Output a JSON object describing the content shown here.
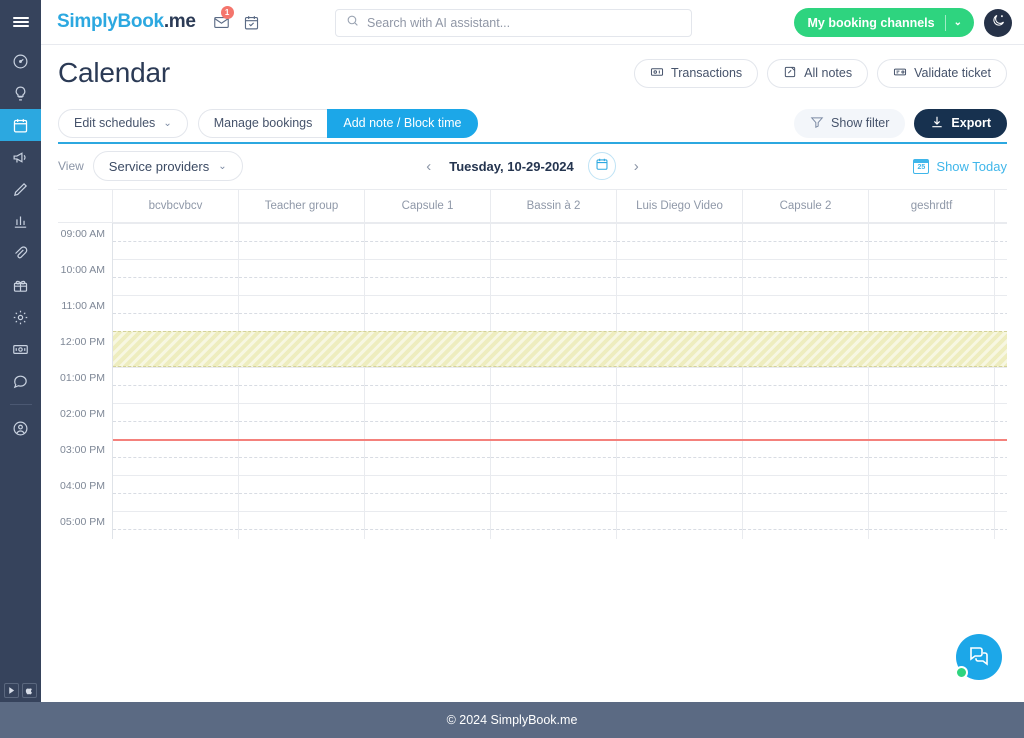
{
  "header": {
    "menu_icon": "hamburger-icon",
    "brand_first": "SimplyBook",
    "brand_second": ".me",
    "mail_icon": "envelope-icon",
    "mail_badge": "1",
    "tasks_icon": "calendar-check-icon",
    "search_placeholder": "Search with AI assistant...",
    "search_value": "",
    "search_icon": "search-icon",
    "booking_channels_label": "My booking channels",
    "booking_channels_icon": "link-icon",
    "booking_channels_chevron": "⌄",
    "theme_toggle_icon": "moon-icon"
  },
  "sidebar": {
    "items": [
      {
        "name": "dashboard",
        "icon": "speedometer-icon",
        "active": false
      },
      {
        "name": "ideas",
        "icon": "lightbulb-icon",
        "active": false
      },
      {
        "name": "calendar",
        "icon": "calendar-icon",
        "active": true
      },
      {
        "name": "marketing",
        "icon": "megaphone-icon",
        "active": false
      },
      {
        "name": "design",
        "icon": "pencil-icon",
        "active": false
      },
      {
        "name": "reports",
        "icon": "bar-chart-icon",
        "active": false
      },
      {
        "name": "integrations",
        "icon": "paperclip-icon",
        "active": false
      },
      {
        "name": "gifts",
        "icon": "gift-icon",
        "active": false
      },
      {
        "name": "settings",
        "icon": "gear-icon",
        "active": false
      },
      {
        "name": "payments",
        "icon": "banknote-icon",
        "active": false
      },
      {
        "name": "chat",
        "icon": "chat-bubble-icon",
        "active": false
      },
      {
        "name": "account",
        "icon": "user-circle-icon",
        "active": false
      }
    ],
    "store_badges": [
      {
        "name": "google-play",
        "icon": "play-triangle-icon"
      },
      {
        "name": "app-store",
        "icon": "apple-icon"
      }
    ]
  },
  "page": {
    "title": "Calendar",
    "actions": [
      {
        "label": "Transactions",
        "icon": "money-icon"
      },
      {
        "label": "All notes",
        "icon": "note-icon"
      },
      {
        "label": "Validate ticket",
        "icon": "ticket-icon"
      }
    ]
  },
  "toolbar": {
    "edit_schedules_label": "Edit schedules",
    "edit_schedules_chevron": "⌄",
    "segments": [
      {
        "label": "Manage bookings",
        "active": false
      },
      {
        "label": "Add note / Block time",
        "active": true
      }
    ],
    "show_filter_label": "Show filter",
    "show_filter_icon": "funnel-icon",
    "export_label": "Export",
    "export_icon": "download-icon"
  },
  "viewbar": {
    "view_label": "View",
    "view_selected": "Service providers",
    "view_chevron": "⌄",
    "prev_arrow": "‹",
    "next_arrow": "›",
    "date_text": "Tuesday, 10-29-2024",
    "date_picker_icon": "calendar-icon",
    "show_today_label": "Show Today",
    "show_today_icon": "calendar-today-icon",
    "show_today_day": "25"
  },
  "calendar": {
    "columns": [
      "bcvbcvbcv",
      "Teacher group",
      "Capsule 1",
      "Bassin à 2",
      "Luis Diego Video",
      "Capsule 2",
      "geshrdtf"
    ],
    "times": [
      "09:00 AM",
      "10:00 AM",
      "11:00 AM",
      "12:00 PM",
      "01:00 PM",
      "02:00 PM",
      "03:00 PM",
      "04:00 PM",
      "05:00 PM"
    ],
    "blocked_time": {
      "label": "",
      "start": "12:00 PM",
      "end": "01:00 PM",
      "color": "#eeedbf"
    },
    "current_time_line": {
      "time": "03:00 PM",
      "color": "#f4817c"
    }
  },
  "fab": {
    "icon": "chat-bubbles-icon",
    "status": "online"
  },
  "footer": {
    "copyright": "© 2024 SimplyBook.me"
  },
  "colors": {
    "accent": "#1ca7e8",
    "sidebar": "#36435c",
    "green": "#2ed47f",
    "dark": "#17314f",
    "footer": "#5b6a83"
  }
}
